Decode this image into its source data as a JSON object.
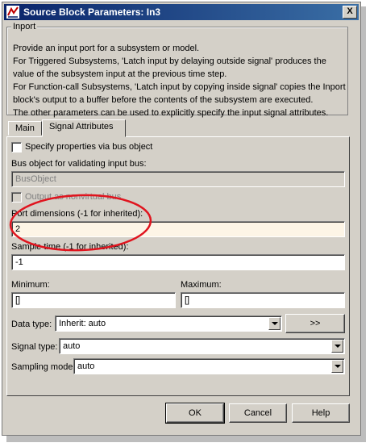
{
  "window": {
    "title": "Source Block Parameters: In3",
    "close_label": "X"
  },
  "group": {
    "label": "Inport",
    "description": [
      "Provide an input port for a subsystem or model.",
      "For Triggered Subsystems, 'Latch input by delaying outside signal' produces the",
      "value of the subsystem input at the previous time step.",
      "For Function-call Subsystems, 'Latch input by copying inside signal' copies the Inport",
      "block's output to a buffer before the contents of the subsystem are executed.",
      "The other parameters can be used to explicitly specify the input signal attributes."
    ]
  },
  "tabs": [
    {
      "label": "Main",
      "active": false
    },
    {
      "label": "Signal Attributes",
      "active": true
    }
  ],
  "fields": {
    "specify_bus_label": "Specify properties via bus object",
    "bus_object_label": "Bus object for validating input bus:",
    "bus_object_value": "BusObject",
    "nonvirtual_label": "Output as nonvirtual bus",
    "port_dims_label": "Port dimensions (-1 for inherited):",
    "port_dims_value": "2",
    "sample_time_label": "Sample time (-1 for inherited):",
    "sample_time_value": "-1",
    "minimum_label": "Minimum:",
    "minimum_value": "[]",
    "maximum_label": "Maximum:",
    "maximum_value": "[]",
    "data_type_label": "Data type:",
    "data_type_value": "Inherit: auto",
    "assistant_button": ">>",
    "signal_type_label": "Signal type:",
    "signal_type_value": "auto",
    "sampling_mode_label": "Sampling mode:",
    "sampling_mode_value": "auto"
  },
  "buttons": {
    "ok": "OK",
    "cancel": "Cancel",
    "help": "Help"
  },
  "annotation_color": "#e0141e"
}
